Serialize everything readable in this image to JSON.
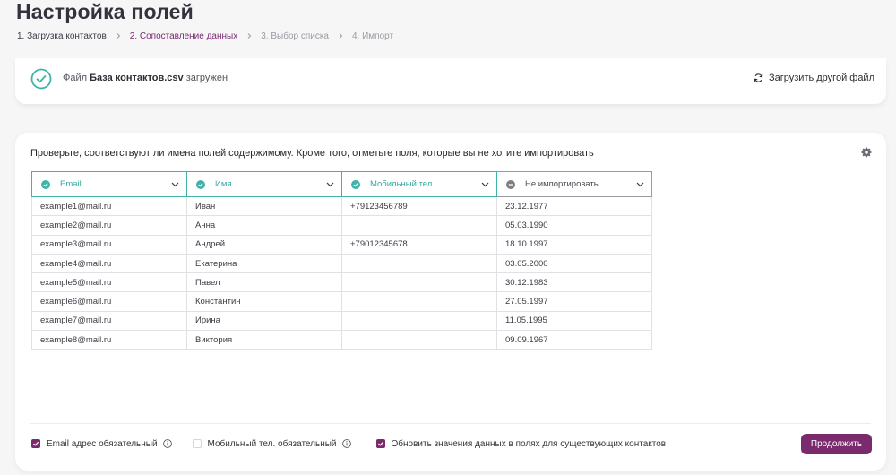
{
  "page": {
    "title": "Настройка полей"
  },
  "breadcrumb": [
    {
      "label": "1. Загрузка контактов",
      "state": "done"
    },
    {
      "label": "2. Сопоставление данных",
      "state": "active"
    },
    {
      "label": "3. Выбор списка",
      "state": "disabled"
    },
    {
      "label": "4. Импорт",
      "state": "disabled"
    }
  ],
  "file_status": {
    "prefix": "Файл",
    "filename": "База контактов.csv",
    "suffix": "загружен",
    "icon": "check-circle-icon",
    "reload_label": "Загрузить другой файл",
    "reload_icon": "refresh-icon"
  },
  "mapping": {
    "instruction": "Проверьте, соответствуют ли имена полей содержимому. Кроме того, отметьте поля, которые вы не хотите импортировать",
    "settings_icon": "gear-icon",
    "columns": [
      {
        "label": "Email",
        "status": "mapped"
      },
      {
        "label": "Имя",
        "status": "mapped"
      },
      {
        "label": "Мобильный тел.",
        "status": "mapped"
      },
      {
        "label": "Не импортировать",
        "status": "ignored"
      }
    ],
    "rows": [
      [
        "example1@mail.ru",
        "Иван",
        "+79123456789",
        "23.12.1977"
      ],
      [
        "example2@mail.ru",
        "Анна",
        "",
        "05.03.1990"
      ],
      [
        "example3@mail.ru",
        "Андрей",
        "+79012345678",
        "18.10.1997"
      ],
      [
        "example4@mail.ru",
        "Екатерина",
        "",
        "03.05.2000"
      ],
      [
        "example5@mail.ru",
        "Павел",
        "",
        "30.12.1983"
      ],
      [
        "example6@mail.ru",
        "Константин",
        "",
        "27.05.1997"
      ],
      [
        "example7@mail.ru",
        "Ирина",
        "",
        "11.05.1995"
      ],
      [
        "example8@mail.ru",
        "Виктория",
        "",
        "09.09.1967"
      ]
    ]
  },
  "footer": {
    "email_required": {
      "label": "Email адрес обязательный",
      "checked": true
    },
    "phone_required": {
      "label": "Мобильный тел. обязательный",
      "checked": false
    },
    "update_existing": {
      "label": "Обновить значения данных в полях для существующих контактов",
      "checked": true
    },
    "continue_label": "Продолжить"
  },
  "colors": {
    "accent": "#7b2a6e",
    "success": "#3fb3a7",
    "muted": "#9a9aa3"
  }
}
